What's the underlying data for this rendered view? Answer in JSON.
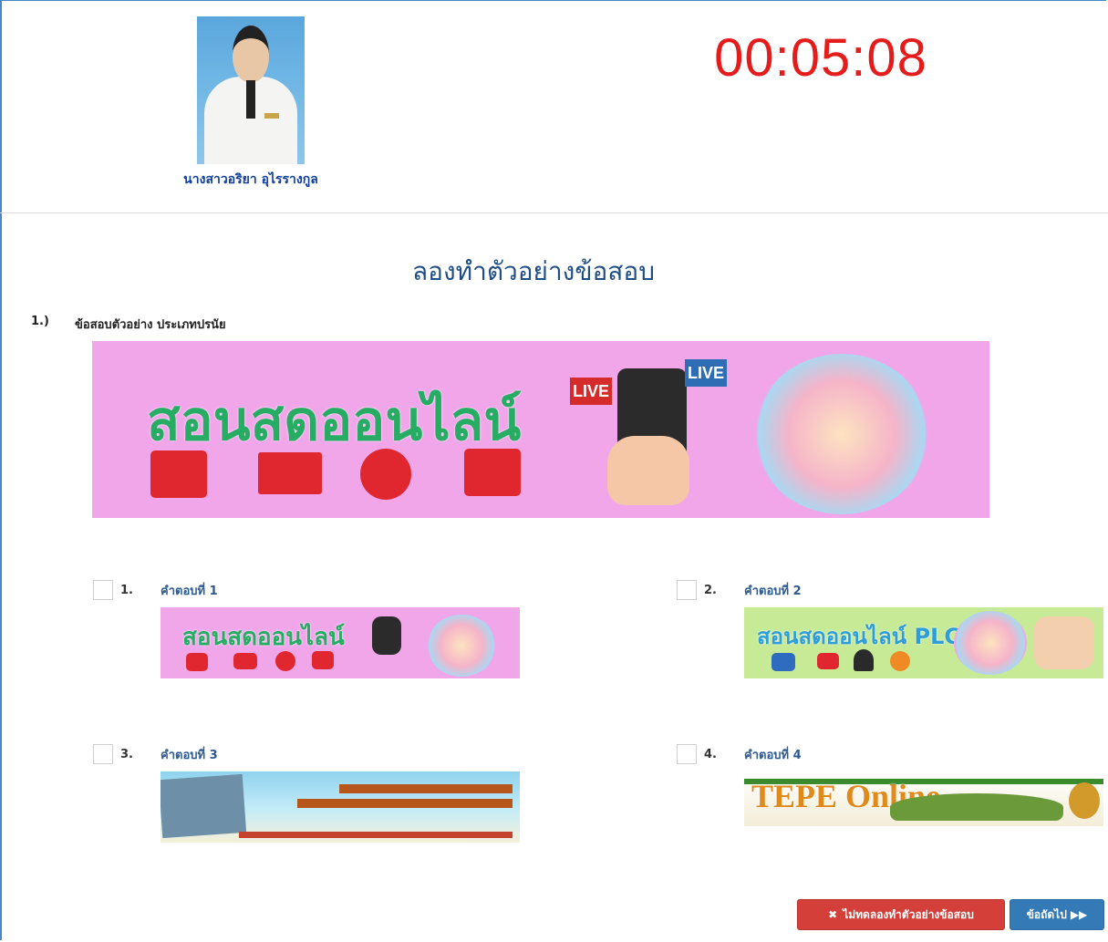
{
  "header": {
    "person_name": "นางสาวอริยา อุไรรางกูล",
    "timer": "00:05:08"
  },
  "page_title": "ลองทำตัวอย่างข้อสอบ",
  "question": {
    "number": "1.)",
    "text": "ข้อสอบตัวอย่าง ประเภทปรนัย",
    "banner_text": "สอนสดออนไลน์",
    "live_tag": "LIVE"
  },
  "answers": [
    {
      "number": "1.",
      "label": "คำตอบที่ 1",
      "image_text": "สอนสดออนไลน์"
    },
    {
      "number": "2.",
      "label": "คำตอบที่ 2",
      "image_text": "สอนสดออนไลน์ PLC"
    },
    {
      "number": "3.",
      "label": "คำตอบที่ 3",
      "image_text": ""
    },
    {
      "number": "4.",
      "label": "คำตอบที่ 4",
      "image_text": "TEPE Online"
    }
  ],
  "buttons": {
    "skip_label": "ไม่ทดลองทำตัวอย่างข้อสอบ",
    "next_label": "ข้อถัดไป"
  },
  "colors": {
    "timer": "#e51c1c",
    "title": "#1f4e86",
    "skip_button": "#d43f3a",
    "next_button": "#337ab7"
  },
  "icons": {
    "skip": "times-circle-icon",
    "next": "forward-icon"
  }
}
